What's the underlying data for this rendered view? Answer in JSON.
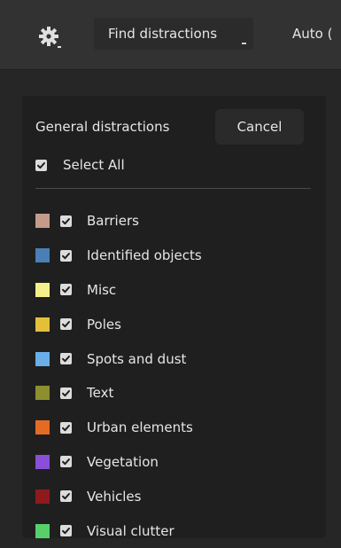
{
  "toolbar": {
    "settings_icon": "gear-icon",
    "find_label": "Find distractions",
    "auto_label": "Auto ("
  },
  "panel": {
    "title": "General distractions",
    "cancel_label": "Cancel",
    "select_all_label": "Select All",
    "select_all_checked": true,
    "categories": [
      {
        "label": "Barriers",
        "color": "#c49a8a",
        "checked": true
      },
      {
        "label": "Identified objects",
        "color": "#4a7fb5",
        "checked": true
      },
      {
        "label": "Misc",
        "color": "#f4ef8a",
        "checked": true
      },
      {
        "label": "Poles",
        "color": "#e2c03a",
        "checked": true
      },
      {
        "label": "Spots and dust",
        "color": "#6aaee8",
        "checked": true
      },
      {
        "label": "Text",
        "color": "#8b8f2e",
        "checked": true
      },
      {
        "label": "Urban elements",
        "color": "#e46b24",
        "checked": true
      },
      {
        "label": "Vegetation",
        "color": "#8a4fd6",
        "checked": true
      },
      {
        "label": "Vehicles",
        "color": "#8e1a1c",
        "checked": true
      },
      {
        "label": "Visual clutter",
        "color": "#58d06a",
        "checked": true
      }
    ]
  }
}
